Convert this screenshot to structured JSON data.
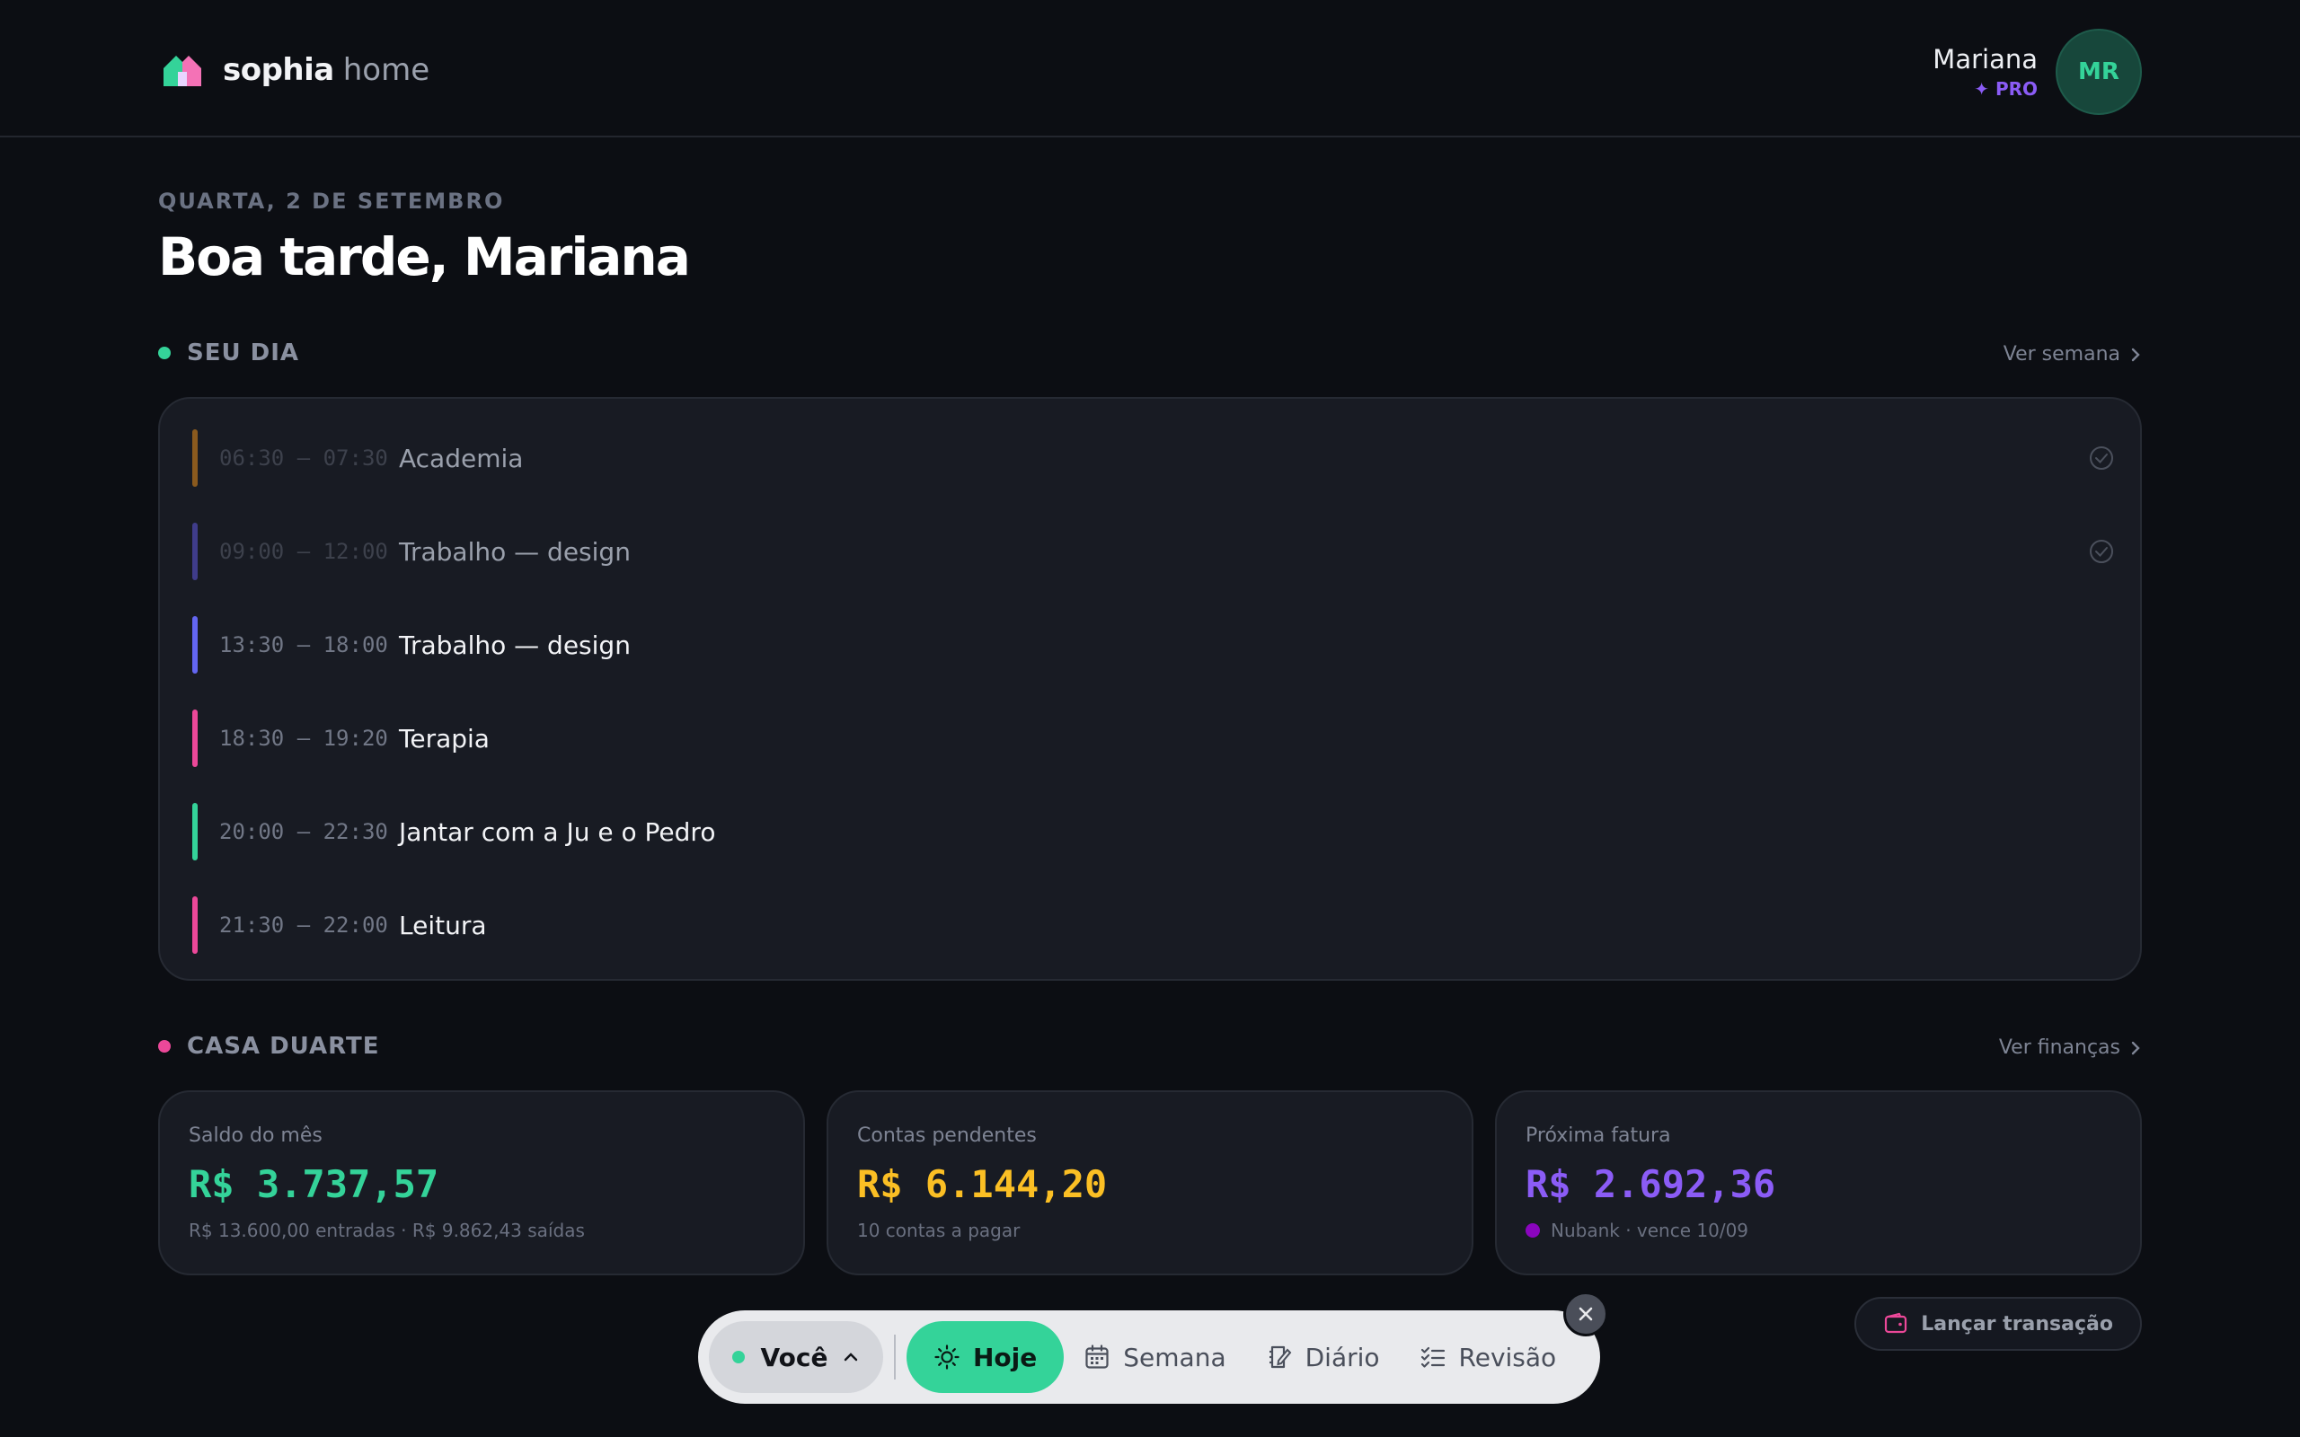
{
  "brand": {
    "name_bold": "sophia",
    "name_light": "home"
  },
  "user": {
    "name": "Mariana",
    "badge": "✦ PRO",
    "initials": "MR"
  },
  "greeting": {
    "date": "QUARTA, 2 DE SETEMBRO",
    "title": "Boa tarde, Mariana"
  },
  "day": {
    "heading": "SEU DIA",
    "link": "Ver semana",
    "events": [
      {
        "time": "06:30 – 07:30",
        "title": "Academia",
        "color": "#8a5a1e",
        "done": true
      },
      {
        "time": "09:00 – 12:00",
        "title": "Trabalho — design",
        "color": "#3f3c8a",
        "done": true
      },
      {
        "time": "13:30 – 18:00",
        "title": "Trabalho — design",
        "color": "#6366f1",
        "done": false
      },
      {
        "time": "18:30 – 19:20",
        "title": "Terapia",
        "color": "#ec4899",
        "done": false
      },
      {
        "time": "20:00 – 22:30",
        "title": "Jantar com a Ju e o Pedro",
        "color": "#34d399",
        "done": false
      },
      {
        "time": "21:30 – 22:00",
        "title": "Leitura",
        "color": "#ec4899",
        "done": false
      }
    ]
  },
  "house": {
    "heading": "CASA DUARTE",
    "link": "Ver finanças",
    "cards": [
      {
        "label": "Saldo do mês",
        "value": "R$ 3.737,57",
        "sub": "R$ 13.600,00 entradas · R$ 9.862,43 saídas",
        "color": "#34d399"
      },
      {
        "label": "Contas pendentes",
        "value": "R$ 6.144,20",
        "sub": "10 contas a pagar",
        "color": "#fbbf24"
      },
      {
        "label": "Próxima fatura",
        "value": "R$ 2.692,36",
        "sub": "Nubank · vence 10/09",
        "color": "#8b5cf6"
      }
    ]
  },
  "nav": {
    "you_label": "Você",
    "items": [
      {
        "label": "Hoje",
        "icon": "sun-icon",
        "active": true
      },
      {
        "label": "Semana",
        "icon": "calendar-icon",
        "active": false
      },
      {
        "label": "Diário",
        "icon": "journal-icon",
        "active": false
      },
      {
        "label": "Revisão",
        "icon": "checklist-icon",
        "active": false
      }
    ]
  },
  "actions": {
    "launch_label": "Lançar transação"
  },
  "colors": {
    "accent": "#34d399",
    "pink": "#ec4899",
    "purple": "#8b5cf6",
    "background": "#0c0e13",
    "card": "#181b23"
  }
}
